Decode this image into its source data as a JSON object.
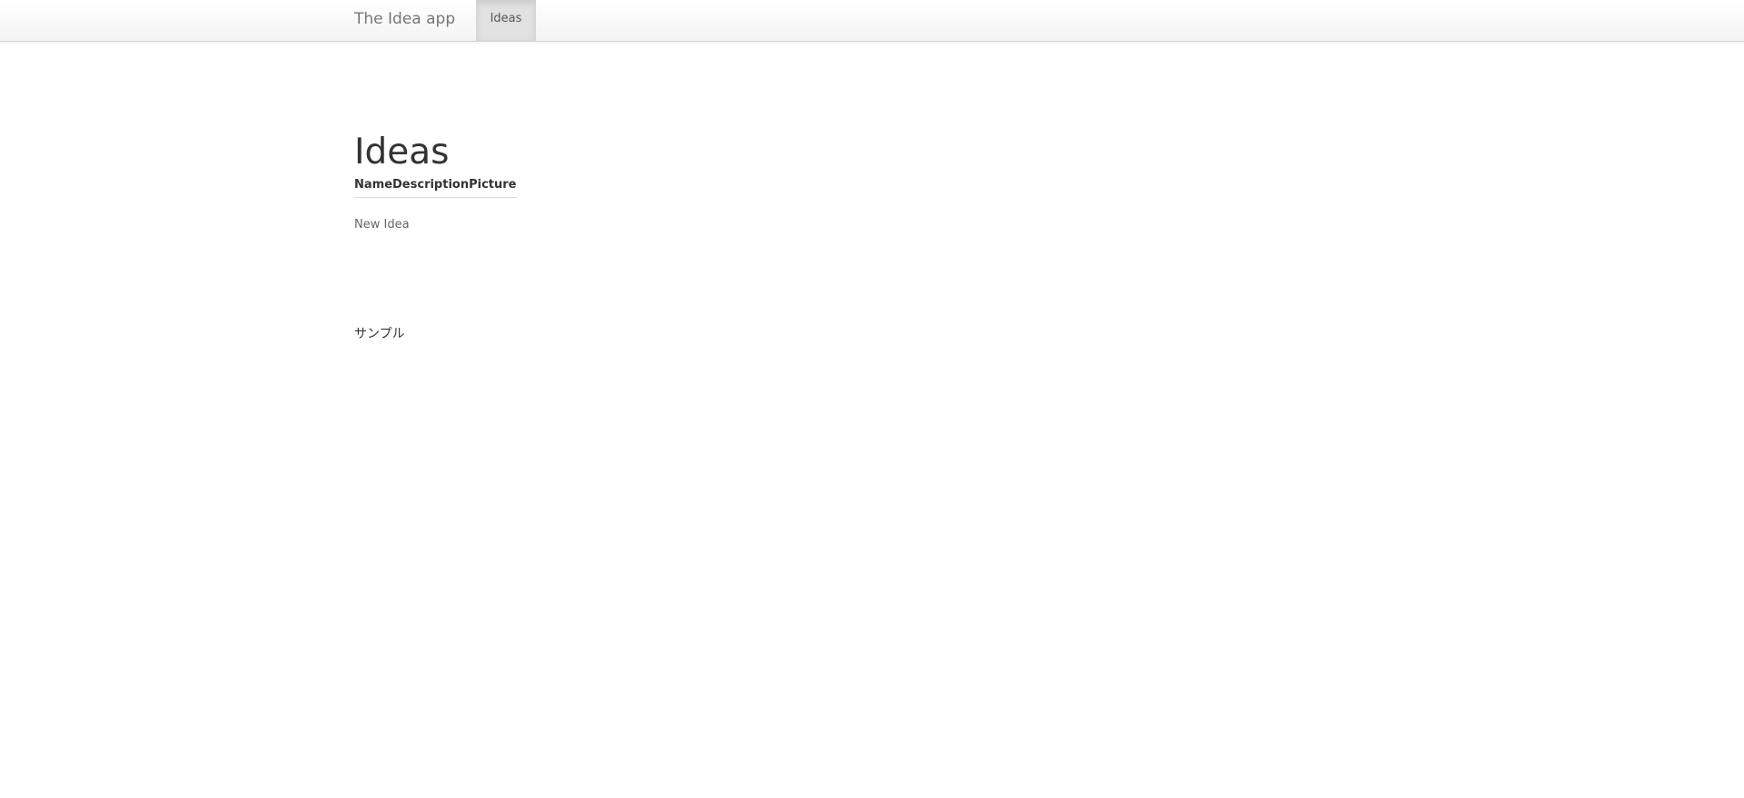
{
  "navbar": {
    "brand": "The Idea app",
    "items": [
      {
        "label": "Ideas",
        "active": true
      }
    ]
  },
  "main": {
    "title": "Ideas",
    "table": {
      "columns": [
        "Name",
        "Description",
        "Picture"
      ],
      "rows": []
    },
    "new_link": "New Idea",
    "footer_text": "サンプル"
  },
  "colors": {
    "navbar_bg": "#f7f7f7",
    "active_nav_bg": "#e1e1e1",
    "text": "#333333",
    "muted_text": "#777777"
  }
}
